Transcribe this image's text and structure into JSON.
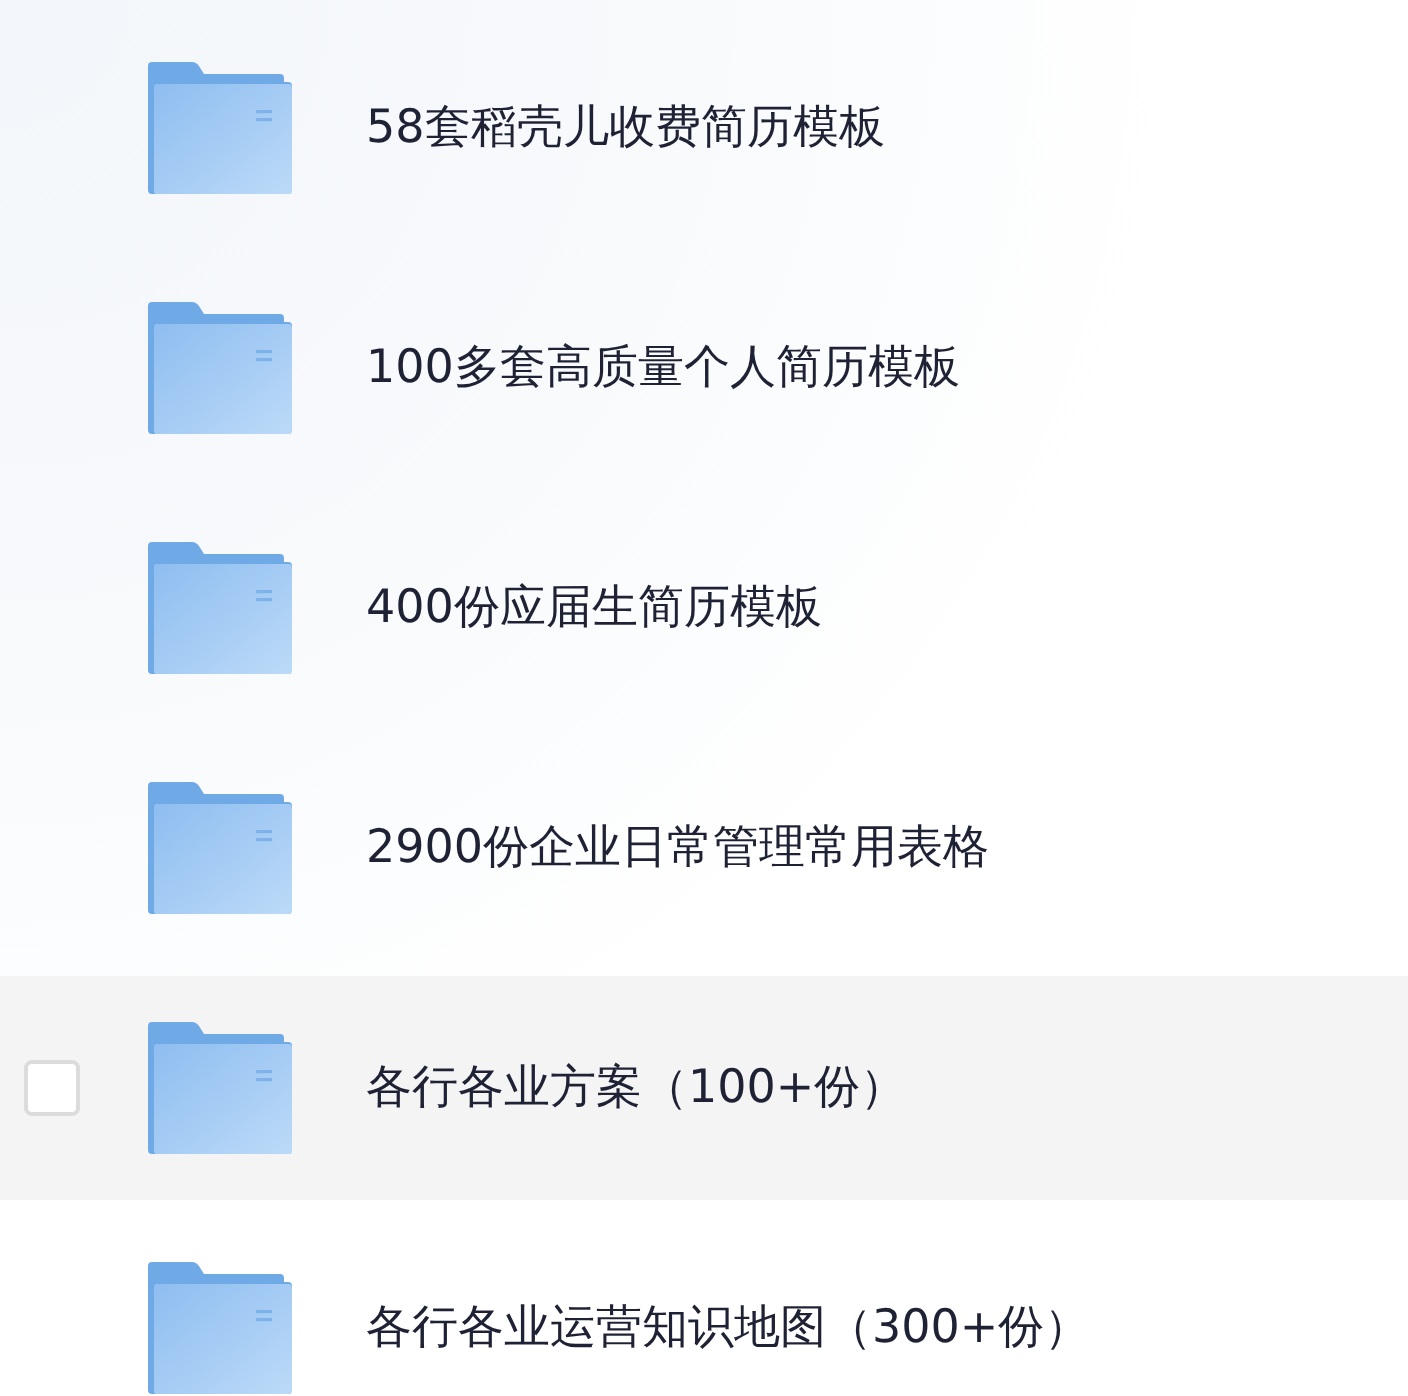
{
  "folders": [
    {
      "name": "58套稻壳儿收费简历模板",
      "highlighted": false,
      "checked": false
    },
    {
      "name": "100多套高质量个人简历模板",
      "highlighted": false,
      "checked": false
    },
    {
      "name": "400份应届生简历模板",
      "highlighted": false,
      "checked": false
    },
    {
      "name": "2900份企业日常管理常用表格",
      "highlighted": false,
      "checked": false
    },
    {
      "name": "各行各业方案（100+份）",
      "highlighted": true,
      "checked": false
    },
    {
      "name": "各行各业运营知识地图（300+份）",
      "highlighted": false,
      "checked": false
    }
  ]
}
